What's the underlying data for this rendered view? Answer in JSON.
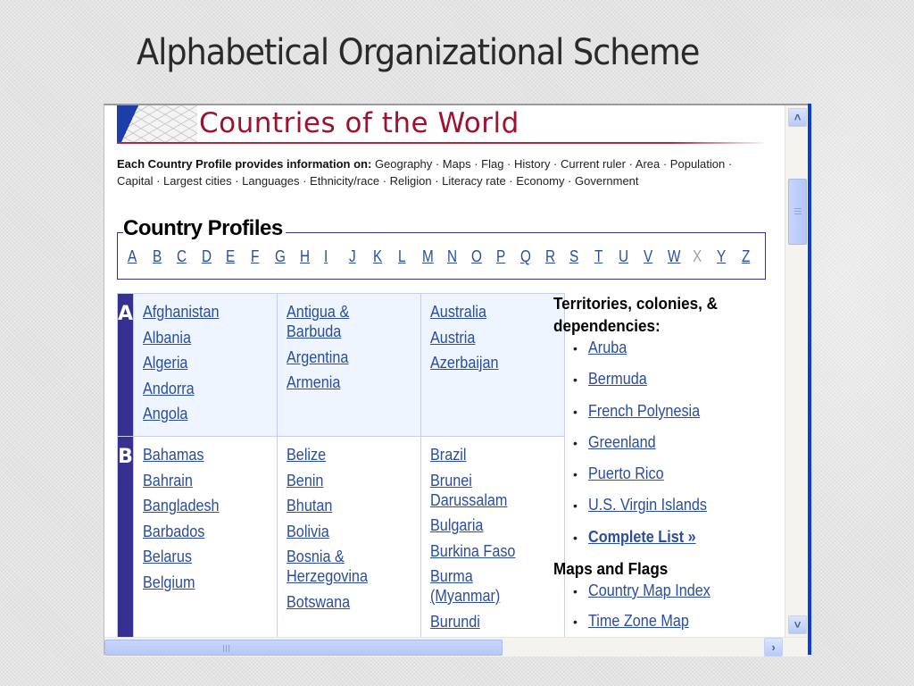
{
  "slide": {
    "title": "Alphabetical Organizational Scheme"
  },
  "page": {
    "banner_title": "Countries of the World",
    "intro_lead": "Each Country Profile provides information on:",
    "intro_topics": "Geography · Maps · Flag · History · Current ruler · Area · Population · Capital · Largest cities · Languages · Ethnicity/race · Religion · Literacy rate · Economy · Government",
    "profiles_title": "Country Profiles",
    "alphabet": [
      {
        "letter": "A",
        "enabled": true
      },
      {
        "letter": "B",
        "enabled": true
      },
      {
        "letter": "C",
        "enabled": true
      },
      {
        "letter": "D",
        "enabled": true
      },
      {
        "letter": "E",
        "enabled": true
      },
      {
        "letter": "F",
        "enabled": true
      },
      {
        "letter": "G",
        "enabled": true
      },
      {
        "letter": "H",
        "enabled": true
      },
      {
        "letter": "I",
        "enabled": true
      },
      {
        "letter": "J",
        "enabled": true
      },
      {
        "letter": "K",
        "enabled": true
      },
      {
        "letter": "L",
        "enabled": true
      },
      {
        "letter": "M",
        "enabled": true
      },
      {
        "letter": "N",
        "enabled": true
      },
      {
        "letter": "O",
        "enabled": true
      },
      {
        "letter": "P",
        "enabled": true
      },
      {
        "letter": "Q",
        "enabled": true
      },
      {
        "letter": "R",
        "enabled": true
      },
      {
        "letter": "S",
        "enabled": true
      },
      {
        "letter": "T",
        "enabled": true
      },
      {
        "letter": "U",
        "enabled": true
      },
      {
        "letter": "V",
        "enabled": true
      },
      {
        "letter": "W",
        "enabled": true
      },
      {
        "letter": "X",
        "enabled": false
      },
      {
        "letter": "Y",
        "enabled": true
      },
      {
        "letter": "Z",
        "enabled": true
      }
    ],
    "sections": [
      {
        "letter": "A",
        "columns": [
          [
            "Afghanistan",
            "Albania",
            "Algeria",
            "Andorra",
            "Angola"
          ],
          [
            "Antigua & Barbuda",
            "Argentina",
            "Armenia"
          ],
          [
            "Australia",
            "Austria",
            "Azerbaijan"
          ]
        ]
      },
      {
        "letter": "B",
        "columns": [
          [
            "Bahamas",
            "Bahrain",
            "Bangladesh",
            "Barbados",
            "Belarus",
            "Belgium"
          ],
          [
            "Belize",
            "Benin",
            "Bhutan",
            "Bolivia",
            "Bosnia & Herzegovina",
            "Botswana"
          ],
          [
            "Brazil",
            "Brunei Darussalam",
            "Bulgaria",
            "Burkina Faso",
            "Burma (Myanmar)",
            "Burundi"
          ]
        ]
      }
    ],
    "territories": {
      "heading": "Territories, colonies, & dependencies:",
      "items": [
        "Aruba",
        "Bermuda",
        "French Polynesia",
        "Greenland",
        "Puerto Rico",
        "U.S. Virgin Islands"
      ],
      "complete_list": "Complete List »"
    },
    "maps_flags": {
      "heading": "Maps and Flags",
      "items": [
        "Country Map Index",
        "Time Zone Map"
      ]
    }
  },
  "scrollbars": {
    "up_icon": "chevron-up",
    "down_icon": "chevron-down",
    "right_icon": "chevron-right"
  }
}
